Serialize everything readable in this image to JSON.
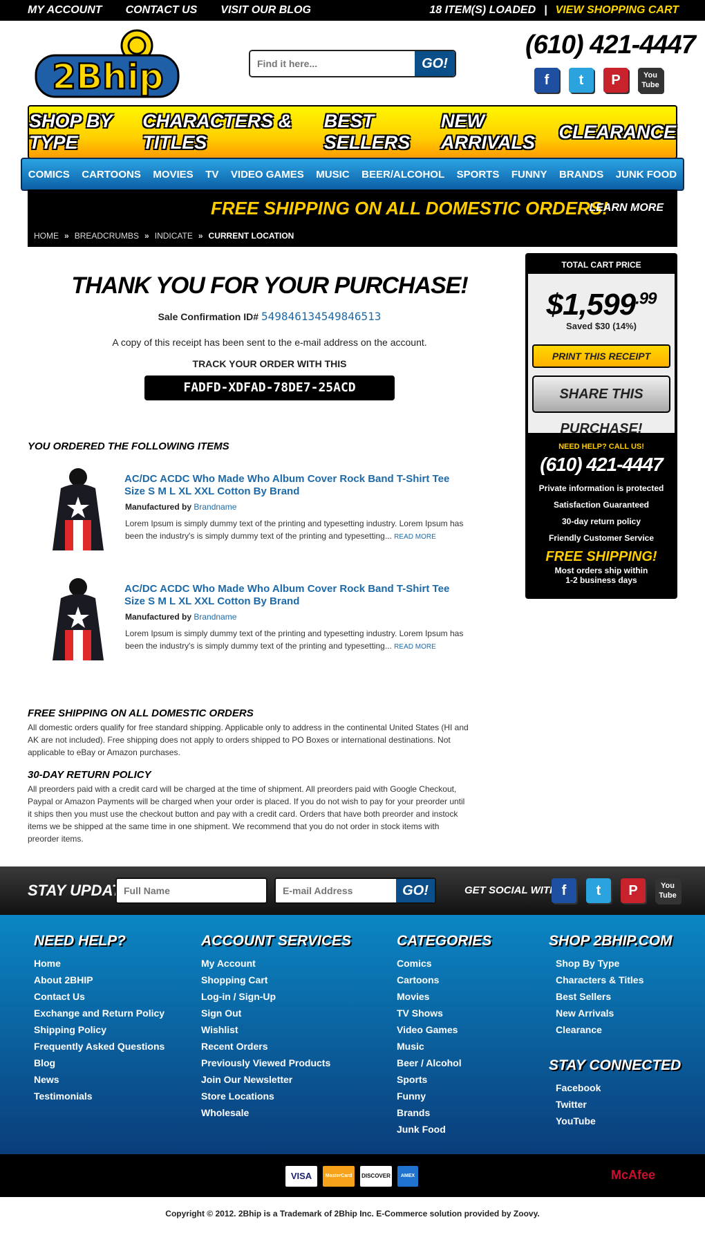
{
  "topbar": {
    "left": [
      "MY ACCOUNT",
      "CONTACT US",
      "VISIT OUR BLOG"
    ],
    "loaded": "18 ITEM(S) LOADED",
    "sep": "|",
    "cart": "VIEW SHOPPING CART"
  },
  "header": {
    "logo": "2Bhip",
    "search_placeholder": "Find it here...",
    "search_btn": "GO!",
    "phone": "(610) 421-4447"
  },
  "nav": {
    "main": [
      "SHOP BY TYPE",
      "CHARACTERS & TITLES",
      "BEST SELLERS",
      "NEW ARRIVALS",
      "CLEARANCE"
    ],
    "sub": [
      "COMICS",
      "CARTOONS",
      "MOVIES",
      "TV",
      "VIDEO GAMES",
      "MUSIC",
      "BEER/ALCOHOL",
      "SPORTS",
      "FUNNY",
      "BRANDS",
      "JUNK FOOD"
    ]
  },
  "promo": {
    "text": "FREE SHIPPING ON ALL DOMESTIC ORDERS!",
    "link": "LEARN MORE"
  },
  "breadcrumb": {
    "items": [
      "HOME",
      "BREADCRUMBS",
      "INDICATE"
    ],
    "sep": "»",
    "current": "CURRENT LOCATION"
  },
  "confirm": {
    "title": "THANK YOU FOR YOUR PURCHASE!",
    "conf_label": "Sale Confirmation ID#",
    "conf_id": "549846134549846513",
    "copy": "A copy of this receipt has been sent to the e-mail address on the account.",
    "track_label": "TRACK YOUR ORDER WITH THIS",
    "track_code": "FADFD-XDFAD-78DE7-25ACD"
  },
  "ordered": {
    "heading": "YOU ORDERED THE FOLLOWING ITEMS",
    "items": [
      {
        "title": "AC/DC ACDC Who Made Who Album Cover Rock Band T-Shirt Tee Size S M L XL XXL Cotton By Brand",
        "mf_label": "Manufactured by",
        "brand": "Brandname",
        "desc": "Lorem Ipsum is simply dummy text of the printing and typesetting industry. Lorem Ipsum has been the industry's  is simply dummy text of the printing and typesetting...",
        "more": "READ MORE"
      },
      {
        "title": "AC/DC ACDC Who Made Who Album Cover Rock Band T-Shirt Tee Size S M L XL XXL Cotton By Brand",
        "mf_label": "Manufactured by",
        "brand": "Brandname",
        "desc": "Lorem Ipsum is simply dummy text of the printing and typesetting industry. Lorem Ipsum has been the industry's  is simply dummy text of the printing and typesetting...",
        "more": "READ MORE"
      }
    ]
  },
  "policies": [
    {
      "title": "FREE SHIPPING ON ALL DOMESTIC ORDERS",
      "text": "All domestic orders qualify for free standard shipping. Applicable only to address in the continental United States (HI and AK are not included). Free shipping does not apply to orders shipped to PO Boxes or international destinations. Not applicable to eBay or Amazon purchases."
    },
    {
      "title": "30-DAY RETURN POLICY",
      "text": "All preorders paid with a credit card will be charged at the time of shipment. All preorders paid with Google Checkout, Paypal or Amazon Payments will be charged when your order is placed. If you do not wish to pay for your preorder until it ships then you must use the checkout button and pay with a credit card. Orders that have both preorder and instock items we be shipped at the same time in one shipment. We recommend that you do not order in stock items with preorder items."
    }
  ],
  "sidebar": {
    "heading": "TOTAL CART PRICE",
    "price": "$1,599",
    "cents": ".99",
    "saved": "Saved $30 (14%)",
    "print": "PRINT THIS RECEIPT",
    "share": "SHARE THIS PURCHASE!",
    "help": "NEED HELP? CALL US!",
    "phone": "(610) 421-4447",
    "features": [
      "Private information is protected",
      "Satisfaction Guaranteed",
      "30-day return policy",
      "Friendly Customer Service"
    ],
    "fs_title": "FREE SHIPPING!",
    "fs_line1": "Most orders ship within",
    "fs_line2": "1-2 business days"
  },
  "stay": {
    "title": "STAY UPDATED!",
    "name_ph": "Full Name",
    "email_ph": "E-mail Address",
    "go": "GO!",
    "social": "GET SOCIAL WITH US!"
  },
  "social_icons": {
    "fb": "f",
    "tw": "t",
    "pi": "P",
    "yt": "You Tube"
  },
  "footer": {
    "cols": [
      {
        "title": "NEED HELP?",
        "links": [
          "Home",
          "About 2BHIP",
          "Contact Us",
          "Exchange and Return Policy",
          "Shipping Policy",
          "Frequently Asked Questions",
          "Blog",
          "News",
          "Testimonials"
        ]
      },
      {
        "title": "ACCOUNT SERVICES",
        "links": [
          "My Account",
          "Shopping Cart",
          "Log-in / Sign-Up",
          "Sign Out",
          "Wishlist",
          "Recent Orders",
          "Previously Viewed Products",
          "Join Our Newsletter",
          "Store Locations",
          "Wholesale"
        ]
      },
      {
        "title": "CATEGORIES",
        "links": [
          "Comics",
          "Cartoons",
          "Movies",
          "TV Shows",
          "Video Games",
          "Music",
          "Beer / Alcohol",
          "Sports",
          "Funny",
          "Brands",
          "Junk Food"
        ]
      },
      {
        "title": "SHOP 2BHIP.COM",
        "links": [
          "Shop By Type",
          "Characters & Titles",
          "Best Sellers",
          "New Arrivals",
          "Clearance"
        ]
      },
      {
        "title": "STAY CONNECTED",
        "links": [
          "Facebook",
          "Twitter",
          "YouTube"
        ]
      }
    ]
  },
  "payment": {
    "cards": [
      "VISA",
      "MasterCard",
      "DISCOVER",
      "AMEX"
    ],
    "security": "McAfee"
  },
  "copyright": "Copyright © 2012. 2Bhip is a Trademark of 2Bhip Inc. E-Commerce solution provided by Zoovy."
}
